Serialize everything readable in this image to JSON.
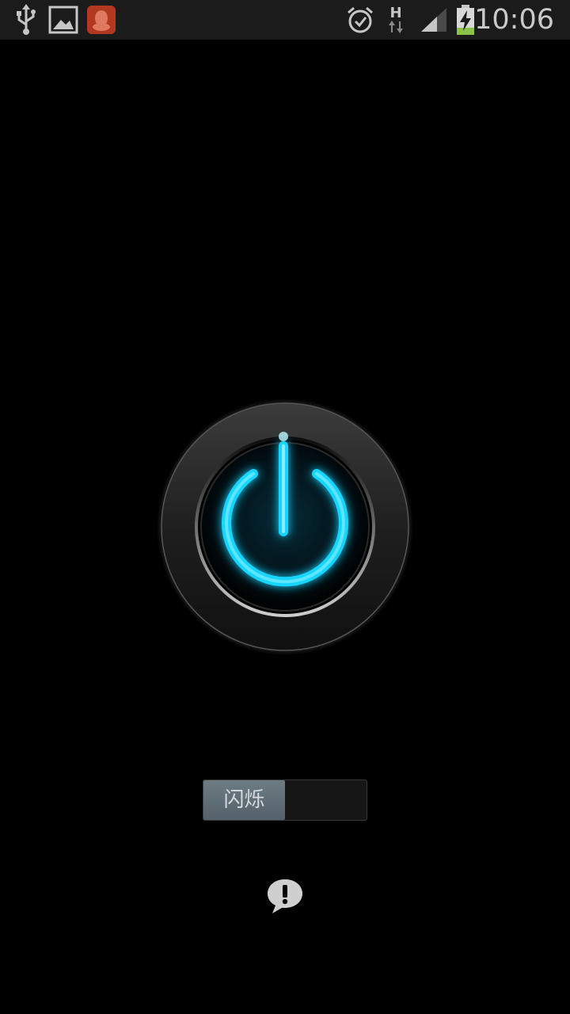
{
  "status_bar": {
    "time": "10:06",
    "network_type": "H",
    "icons": [
      "usb-icon",
      "gallery-icon",
      "qq-icon",
      "alarm-icon",
      "network-h-icon",
      "signal-icon",
      "battery-charging-icon"
    ]
  },
  "main": {
    "power_button_icon": "power-icon",
    "power_accent_color": "#19d6ff",
    "blink_toggle": {
      "label": "闪烁",
      "state": "off"
    },
    "feedback_icon": "feedback-exclamation-icon"
  }
}
